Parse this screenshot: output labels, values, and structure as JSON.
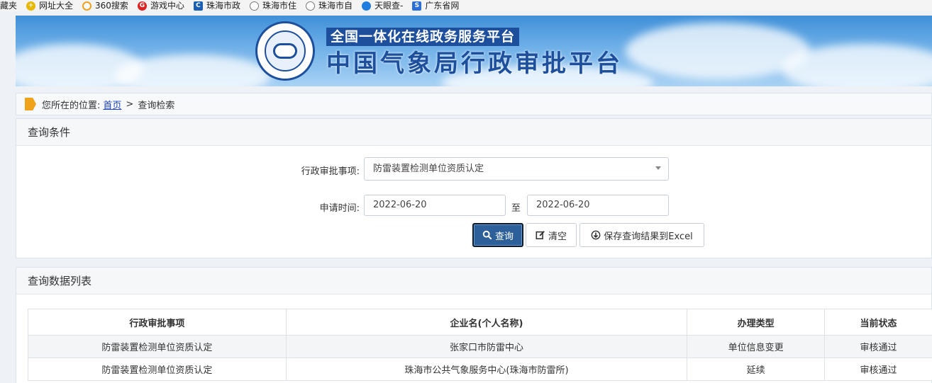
{
  "bookmarks": [
    {
      "label": "藏夹",
      "icon": "none"
    },
    {
      "label": "网址大全",
      "icon": "plus-icon"
    },
    {
      "label": "360搜索",
      "icon": "360-icon"
    },
    {
      "label": "游戏中心",
      "icon": "game-icon"
    },
    {
      "label": "珠海市政",
      "icon": "zhuhai-icon"
    },
    {
      "label": "珠海市住",
      "icon": "globe-icon"
    },
    {
      "label": "珠海市自",
      "icon": "globe-icon"
    },
    {
      "label": "天眼查-",
      "icon": "eye-icon"
    },
    {
      "label": "广东省网",
      "icon": "guangdong-icon"
    }
  ],
  "banner": {
    "subtitle": "全国一体化在线政务服务平台",
    "title": "中国气象局行政审批平台"
  },
  "breadcrumb": {
    "prefix": "您所在的位置:",
    "home": "首页",
    "separator": ">",
    "current": "查询检索"
  },
  "query_panel": {
    "title": "查询条件",
    "item_label": "行政审批事项:",
    "item_value": "防雷装置检测单位资质认定",
    "time_label": "申请时间:",
    "start_date": "2022-06-20",
    "to_label": "至",
    "end_date": "2022-06-20",
    "search_button": "查询",
    "clear_button": "清空",
    "export_button": "保存查询结果到Excel"
  },
  "results_panel": {
    "title": "查询数据列表",
    "columns": [
      "行政审批事项",
      "企业名(个人名称)",
      "办理类型",
      "当前状态"
    ],
    "rows": [
      [
        "防雷装置检测单位资质认定",
        "张家口市防雷中心",
        "单位信息变更",
        "审核通过"
      ],
      [
        "防雷装置检测单位资质认定",
        "珠海市公共气象服务中心(珠海市防雷所)",
        "延续",
        "审核通过"
      ]
    ]
  }
}
